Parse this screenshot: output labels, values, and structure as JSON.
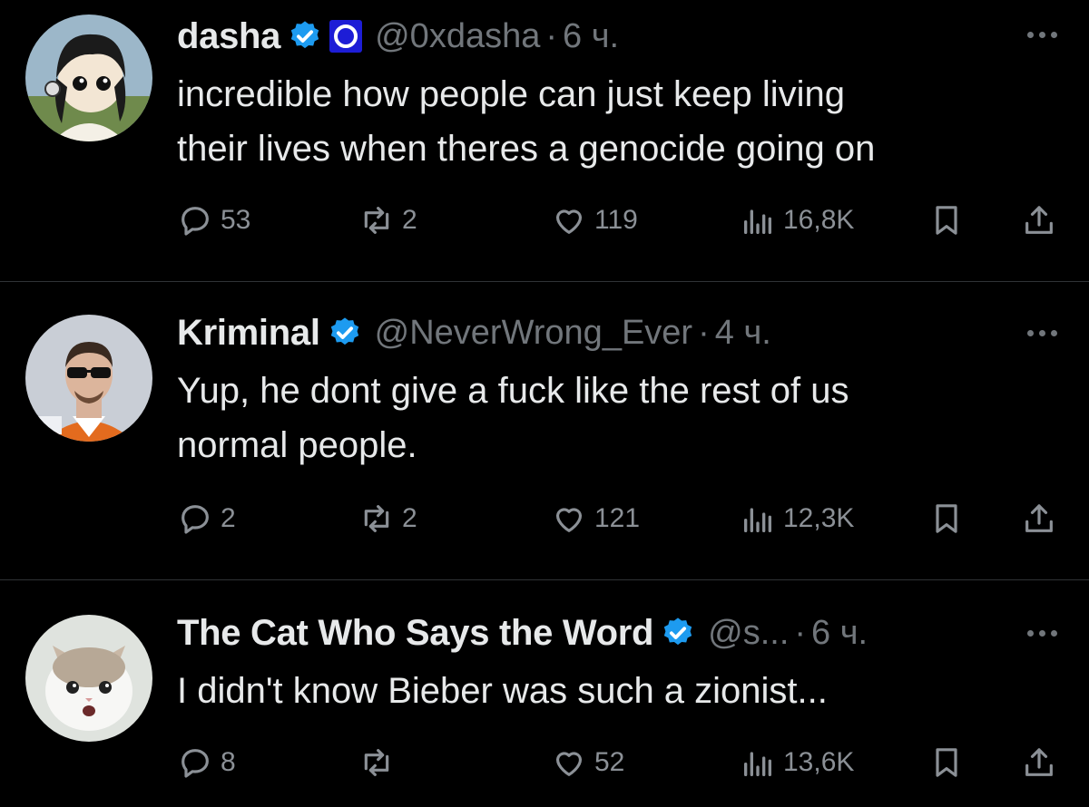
{
  "tweets": [
    {
      "name": "dasha",
      "handle": "@0xdasha",
      "time": "6 ч.",
      "text_lines": [
        "incredible how people can just keep living",
        "their lives when theres a genocide going on"
      ],
      "replies": "53",
      "retweets": "2",
      "likes": "119",
      "views": "16,8K",
      "avatar": "anime-girl-avatar"
    },
    {
      "name": "Kriminal",
      "handle": "@NeverWrong_Ever",
      "time": "4 ч.",
      "text_lines": [
        "Yup, he dont give a fuck like the rest of us",
        "normal people."
      ],
      "replies": "2",
      "retweets": "2",
      "likes": "121",
      "views": "12,3K",
      "avatar": "man-sunglasses-avatar"
    },
    {
      "name": "The Cat Who Says the Word",
      "handle": "@s...",
      "time": "6 ч.",
      "text_lines": [
        "I didn't know Bieber was such a zionist..."
      ],
      "replies": "8",
      "retweets": "",
      "likes": "52",
      "views": "13,6K",
      "avatar": "white-cat-avatar"
    }
  ],
  "separator": "·",
  "icons": {
    "reply": "reply-icon",
    "retweet": "retweet-icon",
    "like": "heart-icon",
    "views": "views-icon",
    "bookmark": "bookmark-icon",
    "share": "share-icon",
    "verified": "verified-badge-icon",
    "more": "more-icon"
  },
  "colors": {
    "background": "#000000",
    "text": "#e7e9ea",
    "muted": "#71767b",
    "verified": "#1d9bf0",
    "org_badge": "#1d1dd6",
    "divider": "#2f3336"
  }
}
